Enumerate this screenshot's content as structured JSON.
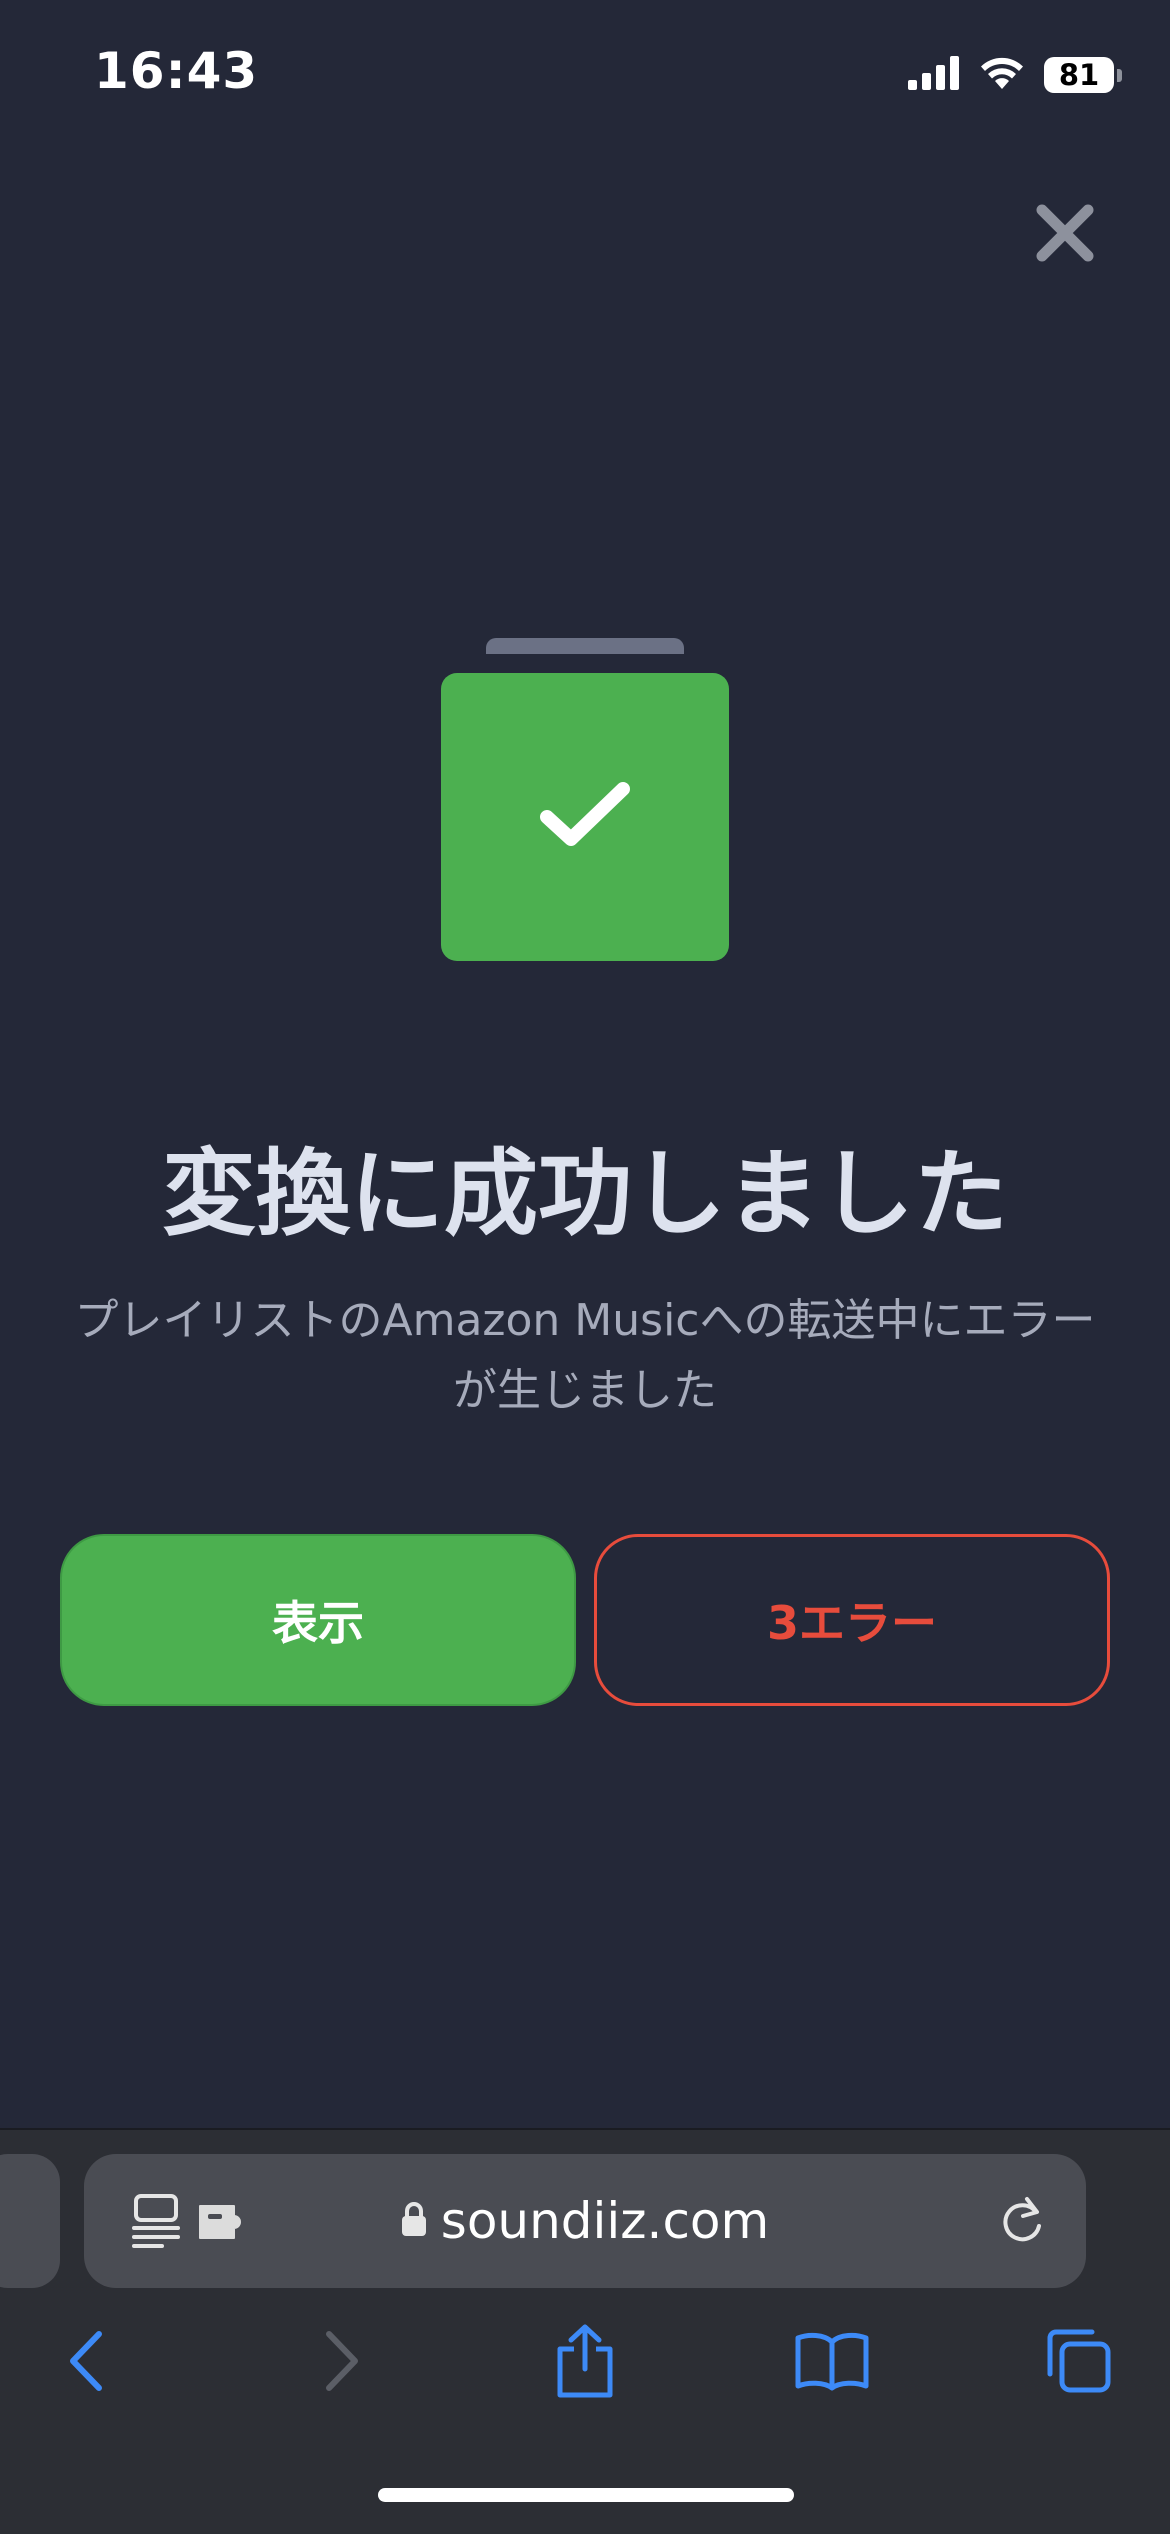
{
  "status_bar": {
    "time": "16:43",
    "battery": "81"
  },
  "icons": {
    "close": "close-icon",
    "check": "checkmark-icon",
    "signal": "cellular-signal-icon",
    "wifi": "wifi-icon",
    "page": "page-format-icon",
    "extension": "extension-puzzle-icon",
    "lock": "lock-icon",
    "reload": "reload-icon",
    "back": "chevron-left-icon",
    "forward": "chevron-right-icon",
    "share": "share-icon",
    "bookmarks": "book-icon",
    "tabs": "tabs-icon"
  },
  "result": {
    "title": "変換に成功しました",
    "message": "プレイリストのAmazon Musicへの転送中にエラーが生じました"
  },
  "actions": {
    "view_label": "表示",
    "errors_label": "3エラー"
  },
  "browser": {
    "url": "soundiiz.com"
  },
  "colors": {
    "background": "#242838",
    "success": "#4cb050",
    "error": "#e74c3c",
    "browser_accent": "#3d8af7"
  }
}
